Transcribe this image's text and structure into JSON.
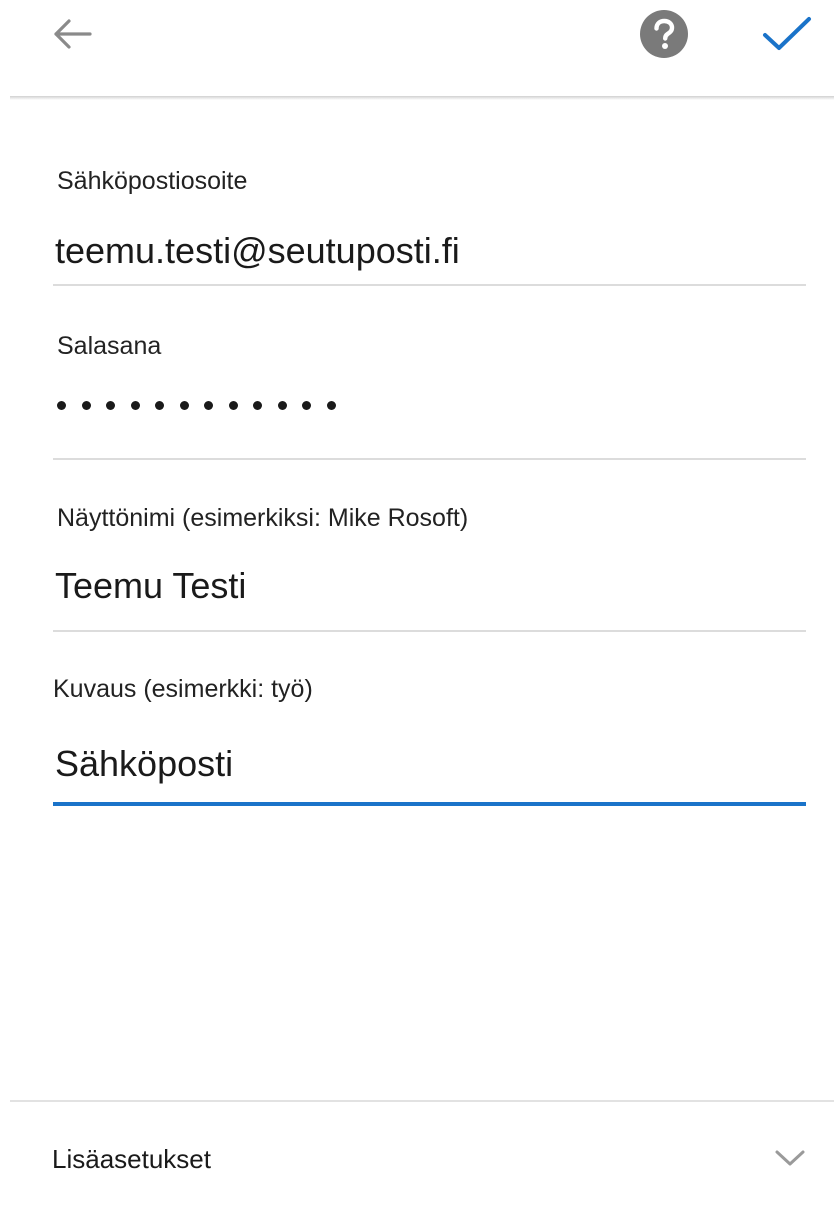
{
  "topbar": {
    "back_icon": "arrow-left-icon",
    "help_icon": "question-circle-icon",
    "confirm_icon": "checkmark-icon",
    "accent_color": "#1a73c9"
  },
  "form": {
    "email": {
      "label": "Sähköpostiosoite",
      "value": "teemu.testi@seutuposti.fi"
    },
    "password": {
      "label": "Salasana",
      "masked_length": 12
    },
    "display_name": {
      "label": "Näyttönimi (esimerkiksi: Mike Rosoft)",
      "value": "Teemu Testi"
    },
    "description": {
      "label": "Kuvaus (esimerkki: työ)",
      "value": "Sähköposti"
    }
  },
  "advanced": {
    "label": "Lisäasetukset",
    "icon": "chevron-down-icon"
  }
}
